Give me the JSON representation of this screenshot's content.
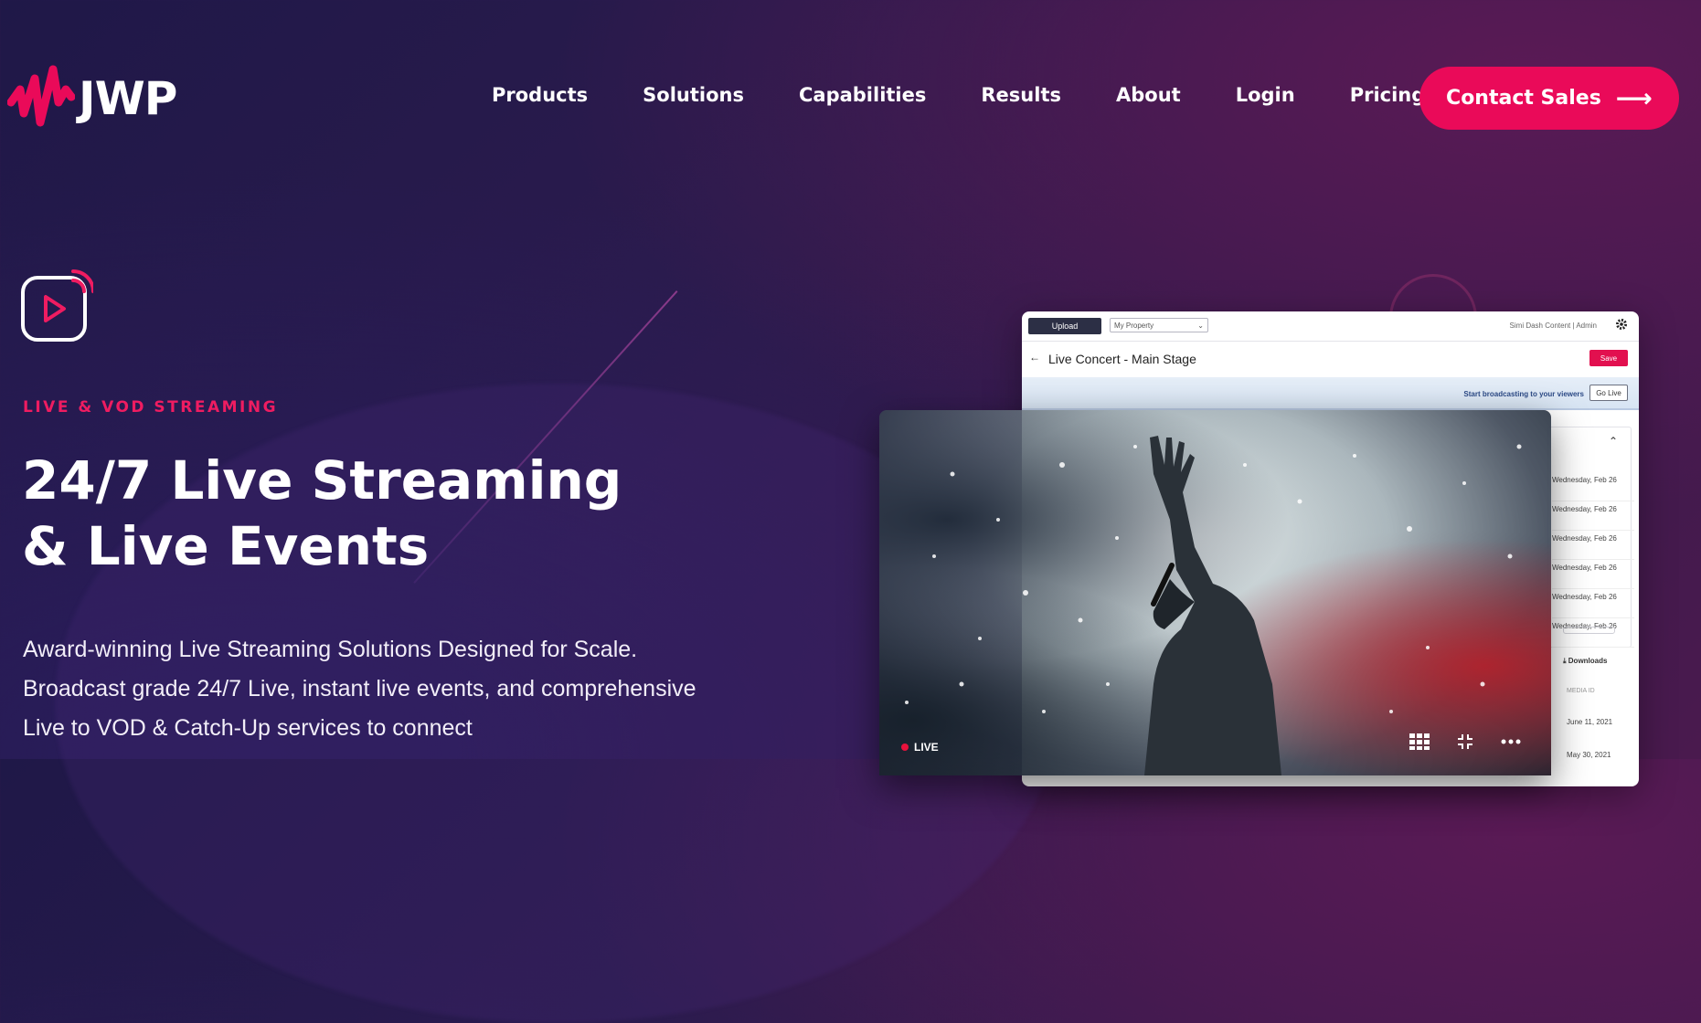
{
  "brand": {
    "logo_text": "JWP",
    "accent": "#ea0a59",
    "eyebrow_color": "#ef1c61"
  },
  "nav": {
    "items": [
      {
        "label": "Products"
      },
      {
        "label": "Solutions"
      },
      {
        "label": "Capabilities"
      },
      {
        "label": "Results"
      },
      {
        "label": "About"
      },
      {
        "label": "Login"
      },
      {
        "label": "Pricing"
      }
    ],
    "cta_label": "Contact Sales",
    "cta_icon": "arrow-right-icon"
  },
  "hero": {
    "icon": "live-stream-icon",
    "eyebrow": "LIVE & VOD STREAMING",
    "headline_line1": "24/7 Live Streaming",
    "headline_line2": "& Live Events",
    "paragraph": "Award-winning Live Streaming Solutions Designed for Scale. Broadcast grade 24/7 Live, instant live events, and comprehensive Live to VOD & Catch-Up services to connect"
  },
  "dashboard": {
    "upload_label": "Upload",
    "property_select": "My Property",
    "account_text": "Simi Dash Content | Admin",
    "title": "Live Concert - Main Stage",
    "save_label": "Save",
    "golive_text": "Start broadcasting to your viewers",
    "golive_label": "Go Live",
    "dates": [
      "Wednesday, Feb 26",
      "Wednesday, Feb 26",
      "Wednesday, Feb 26",
      "Wednesday, Feb 26",
      "Wednesday, Feb 26",
      "Wednesday, Feb 26"
    ],
    "downloads_label": "Downloads",
    "media_id_label": "MEDIA ID",
    "row_dates": [
      "June 11, 2021",
      "May 30, 2021"
    ]
  },
  "video": {
    "live_label": "LIVE",
    "controls": [
      "grid-icon",
      "minimize-icon",
      "more-icon"
    ]
  }
}
